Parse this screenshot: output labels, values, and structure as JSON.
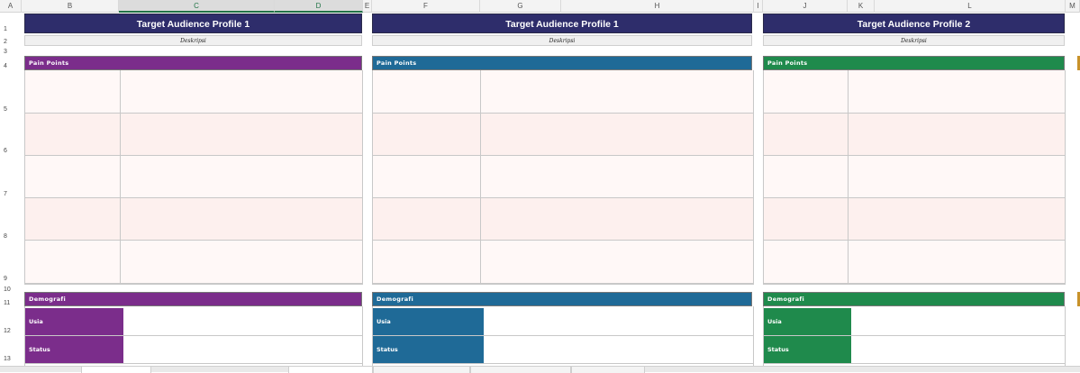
{
  "columns": [
    "A",
    "B",
    "C",
    "D",
    "E",
    "F",
    "G",
    "H",
    "I",
    "J",
    "K",
    "L",
    "M"
  ],
  "rows": [
    "1",
    "2",
    "3",
    "4",
    "5",
    "6",
    "7",
    "8",
    "9",
    "10",
    "11",
    "12",
    "13"
  ],
  "profiles": [
    {
      "title": "Target Audience Profile 1",
      "description": "Deskripsi",
      "pain_points_label": "Pain Points",
      "demografi_label": "Demografi",
      "demo_fields": [
        "Usia",
        "Status"
      ],
      "color": "#7b2d8b"
    },
    {
      "title": "Target Audience Profile 1",
      "description": "Deskripsi",
      "pain_points_label": "Pain Points",
      "demografi_label": "Demografi",
      "demo_fields": [
        "Usia",
        "Status"
      ],
      "color": "#1f6a97"
    },
    {
      "title": "Target Audience Profile 2",
      "description": "Deskripsi",
      "pain_points_label": "Pain Points",
      "demografi_label": "Demografi",
      "demo_fields": [
        "Usia",
        "Status"
      ],
      "color": "#1f8a4c"
    }
  ],
  "colors": {
    "title_bg": "#2e2d6b",
    "row_tint": "#fdf0ee",
    "row_light": "#fff8f7",
    "edge_accent": "#c8922a"
  }
}
